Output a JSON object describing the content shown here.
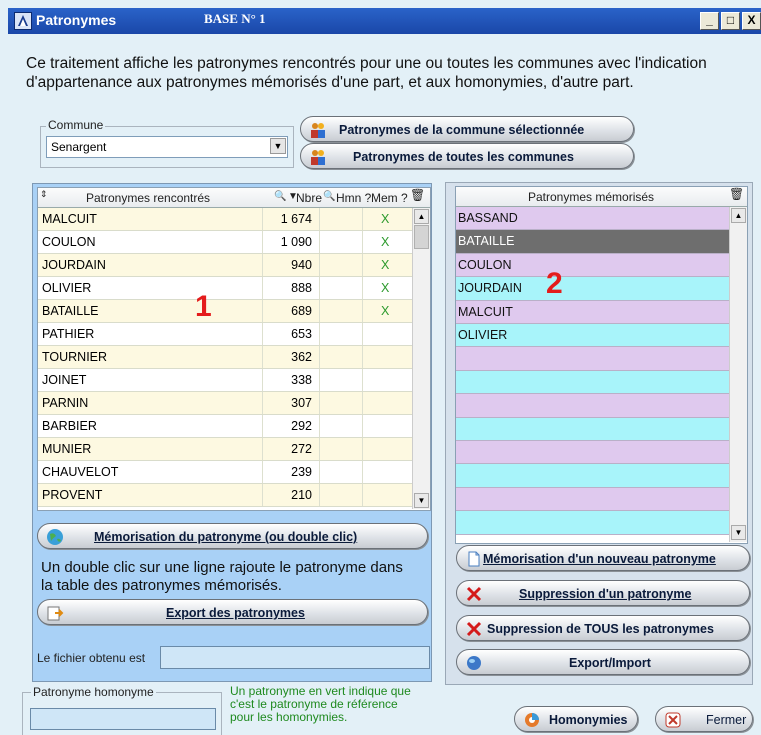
{
  "window": {
    "title": "Patronymes",
    "base": "BASE N° 1",
    "min": "_",
    "max": "□",
    "close": "X"
  },
  "description": "Ce traitement affiche les patronymes rencontrés pour une ou toutes les communes avec l'indication d'appartenance aux patronymes mémorisés d'une part, et aux homonymies, d'autre part.",
  "commune": {
    "label": "Commune",
    "value": "Senargent"
  },
  "buttons": {
    "selected_commune": "Patronymes de la commune sélectionnée",
    "all_communes": "Patronymes de toutes les communes",
    "memorize": "Mémorisation du patronyme (ou double clic)",
    "export": "Export des patronymes",
    "new_memorize": "Mémorisation d'un nouveau patronyme",
    "delete_one": "Suppression d'un patronyme",
    "delete_all": "Suppression de TOUS les patronymes",
    "export_import": "Export/Import",
    "homonymies": "Homonymies",
    "close": "Fermer"
  },
  "table1": {
    "headers": {
      "name": "Patronymes rencontrés",
      "count": "Nbre",
      "hmn": "Hmn ?",
      "mem": "Mem ?"
    },
    "rows": [
      {
        "name": "MALCUIT",
        "count": "1 674",
        "mem": "X"
      },
      {
        "name": "COULON",
        "count": "1 090",
        "mem": "X"
      },
      {
        "name": "JOURDAIN",
        "count": "940",
        "mem": "X"
      },
      {
        "name": "OLIVIER",
        "count": "888",
        "mem": "X"
      },
      {
        "name": "BATAILLE",
        "count": "689",
        "mem": "X"
      },
      {
        "name": "PATHIER",
        "count": "653",
        "mem": ""
      },
      {
        "name": "TOURNIER",
        "count": "362",
        "mem": ""
      },
      {
        "name": "JOINET",
        "count": "338",
        "mem": ""
      },
      {
        "name": "PARNIN",
        "count": "307",
        "mem": ""
      },
      {
        "name": "BARBIER",
        "count": "292",
        "mem": ""
      },
      {
        "name": "MUNIER",
        "count": "272",
        "mem": ""
      },
      {
        "name": "CHAUVELOT",
        "count": "239",
        "mem": ""
      },
      {
        "name": "PROVENT",
        "count": "210",
        "mem": ""
      }
    ]
  },
  "table2": {
    "header": "Patronymes mémorisés",
    "rows": [
      "BASSAND",
      "BATAILLE",
      "COULON",
      "JOURDAIN",
      "MALCUIT",
      "OLIVIER",
      "",
      "",
      "",
      "",
      "",
      "",
      "",
      ""
    ],
    "selected_index": 1
  },
  "labels": {
    "marker1": "1",
    "marker2": "2",
    "hint": "Un double clic sur une ligne rajoute le patronyme dans la table des patronymes mémorisés.",
    "file_obtained": "Le fichier obtenu est",
    "homonym_group": "Patronyme homonyme",
    "green_note": "Un patronyme en vert indique que c'est le patronyme de référence pour les homonymies."
  },
  "colors": {
    "row_odd": "#fdf9e1",
    "row_even": "#ffffff",
    "mem_pink": "#dfc9ee",
    "mem_cyan": "#a8f4fa",
    "selected": "#6e6e6e",
    "check_green": "#2c9a2c",
    "marker_red": "#e41c1c"
  },
  "icons": {
    "people": "people-icon",
    "memo": "earth-icon",
    "export": "export-icon",
    "doc": "document-icon",
    "delete": "red-x-icon",
    "globe": "globe-icon",
    "close": "close-x-icon"
  }
}
